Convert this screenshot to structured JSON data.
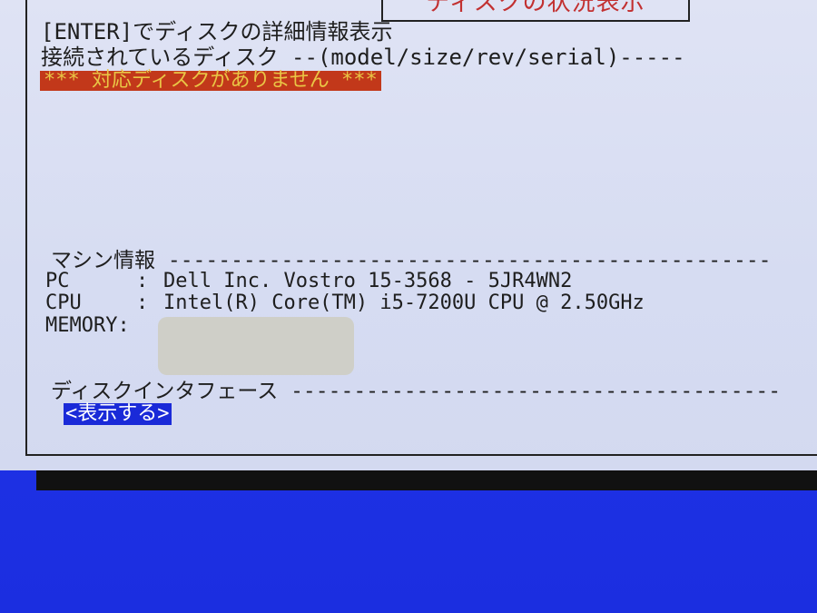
{
  "title": "ディスクの状況表示",
  "instruction": "[ENTER]でディスクの詳細情報表示",
  "disks_header": "接続されているディスク --(model/size/rev/serial)-----",
  "no_disk_warning": "*** 対応ディスクがありません ***",
  "machine": {
    "header": "マシン情報 ------------------------------------------------",
    "rows": [
      {
        "key": "PC",
        "sep": ":",
        "value": "Dell Inc. Vostro 15-3568 - 5JR4WN2"
      },
      {
        "key": "CPU",
        "sep": ":",
        "value": "Intel(R) Core(TM) i5-7200U CPU @ 2.50GHz"
      },
      {
        "key": "MEMORY",
        "sep": ":",
        "value": ""
      }
    ]
  },
  "interface": {
    "header": "ディスクインタフェース ---------------------------------------",
    "show_label": "<表示する>"
  },
  "colors": {
    "background_blue": "#1d2fe8",
    "dialog": "#dfe3f4",
    "title_red": "#c23030",
    "warning_bg": "#c2381a",
    "warning_fg": "#e9c545",
    "button_bg": "#1a2ad8"
  }
}
